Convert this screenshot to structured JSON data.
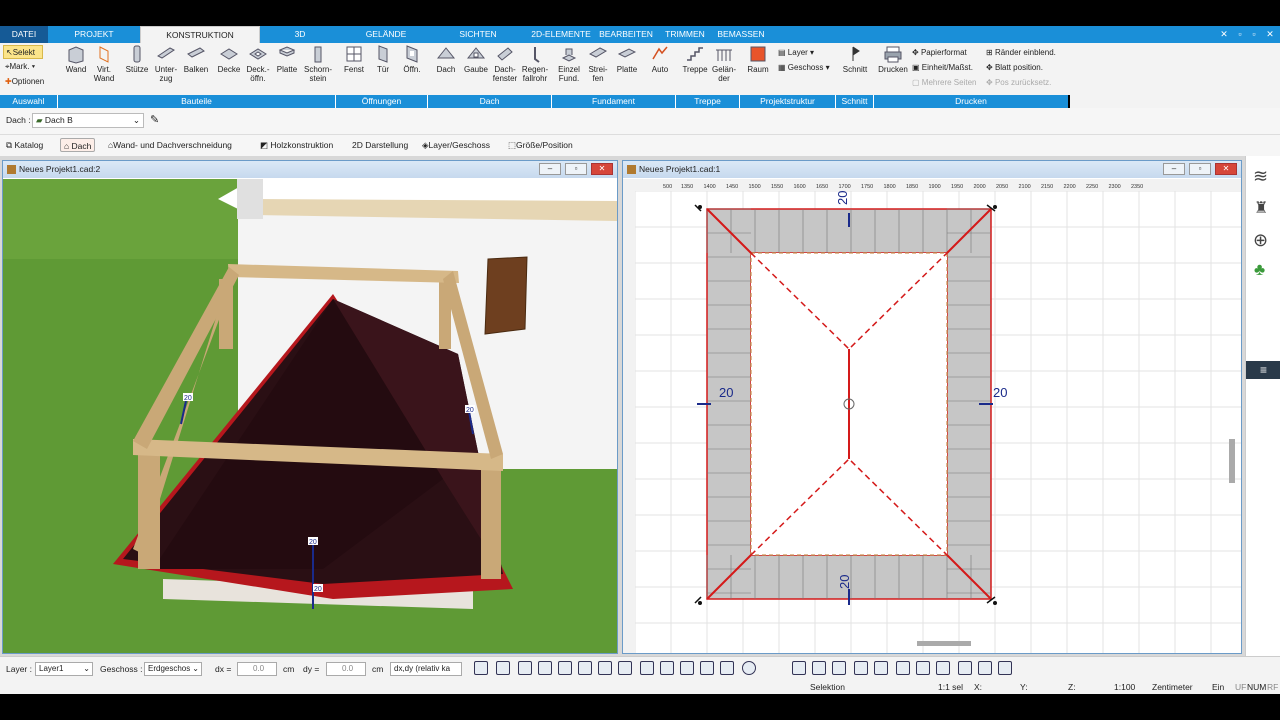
{
  "menu": {
    "tabs": [
      "DATEI",
      "PROJEKT",
      "KONSTRUKTION",
      "3D",
      "GELÄNDE",
      "SICHTEN",
      "2D-ELEMENTE",
      "BEARBEITEN",
      "TRIMMEN",
      "BEMASSEN"
    ],
    "active": "KONSTRUKTION"
  },
  "ribbon": {
    "auswahl": {
      "select": "Selekt",
      "mark": "Mark.",
      "options": "Optionen"
    },
    "bauteile": [
      "Wand",
      "Virt. Wand",
      "Stütze",
      "Unter-zug",
      "Balken",
      "Decke",
      "Deck.-öffn.",
      "Platte",
      "Schorn-stein"
    ],
    "oeffnungen": [
      "Fenst",
      "Tür",
      "Öffn."
    ],
    "dach": [
      "Dach",
      "Gaube",
      "Dach-fenster",
      "Regen-fallrohr"
    ],
    "fundament": [
      "Einzel Fund.",
      "Strei-fen",
      "Platte",
      "Auto"
    ],
    "treppe": [
      "Treppe",
      "Gelän-der"
    ],
    "projektstruktur": {
      "raum": "Raum",
      "layer": "Layer",
      "geschoss": "Geschoss"
    },
    "schnitt": "Schnitt",
    "drucken": {
      "drucken": "Drucken",
      "papier": "Papierformat",
      "einheit": "Einheit/Maßst.",
      "mehrere": "Mehrere Seiten",
      "raender": "Ränder einblend.",
      "blatt": "Blatt position.",
      "pos": "Pos zurücksetz."
    },
    "groups": [
      "Auswahl",
      "Bauteile",
      "Öffnungen",
      "Dach",
      "Fundament",
      "Treppe",
      "Projektstruktur",
      "Schnitt",
      "Drucken"
    ]
  },
  "dachbar": {
    "label": "Dach :",
    "value": "Dach B"
  },
  "toolbar3": [
    "Katalog",
    "Dach",
    "Wand- und Dachverschneidung",
    "Holzkonstruktion",
    "2D Darstellung",
    "Layer/Geschoss",
    "Größe/Position"
  ],
  "windows": {
    "left": {
      "title": "Neues Projekt1.cad:2"
    },
    "right": {
      "title": "Neues Projekt1.cad:1"
    }
  },
  "plan": {
    "ruler": [
      "1350",
      "1400",
      "1450",
      "1500",
      "1550",
      "1600",
      "1650",
      "1700",
      "1750",
      "1800",
      "1850",
      "1900",
      "1950",
      "2000",
      "2050",
      "2100",
      "2150",
      "2200",
      "2250",
      "2300",
      "2350"
    ],
    "ruler_first": "500",
    "dims": {
      "top": "20",
      "left": "20",
      "right": "20",
      "bottom": "20"
    }
  },
  "scene3d": {
    "dim_labels": [
      "20",
      "20",
      "20",
      "20"
    ]
  },
  "status": {
    "layer_label": "Layer :",
    "layer_value": "Layer1",
    "geschoss_label": "Geschoss :",
    "geschoss_value": "Erdgeschos",
    "dx_label": "dx =",
    "dx_value": "0.0",
    "dy_label": "dy =",
    "dy_value": "0.0",
    "unit": "cm",
    "mode": "dx,dy (relativ ka",
    "selektion": "Selektion",
    "sel": "1:1 sel",
    "x": "X:",
    "y": "Y:",
    "z": "Z:",
    "scale": "1:100",
    "unitname": "Zentimeter",
    "ein": "Ein",
    "uf": "UF",
    "num": "NUM",
    "rf": "RF"
  },
  "colors": {
    "accent": "#1a8fd8",
    "roof": "#2a0f14",
    "roofedge": "#d41a1a",
    "grass": "#5f9a35",
    "wood": "#c9a877"
  }
}
